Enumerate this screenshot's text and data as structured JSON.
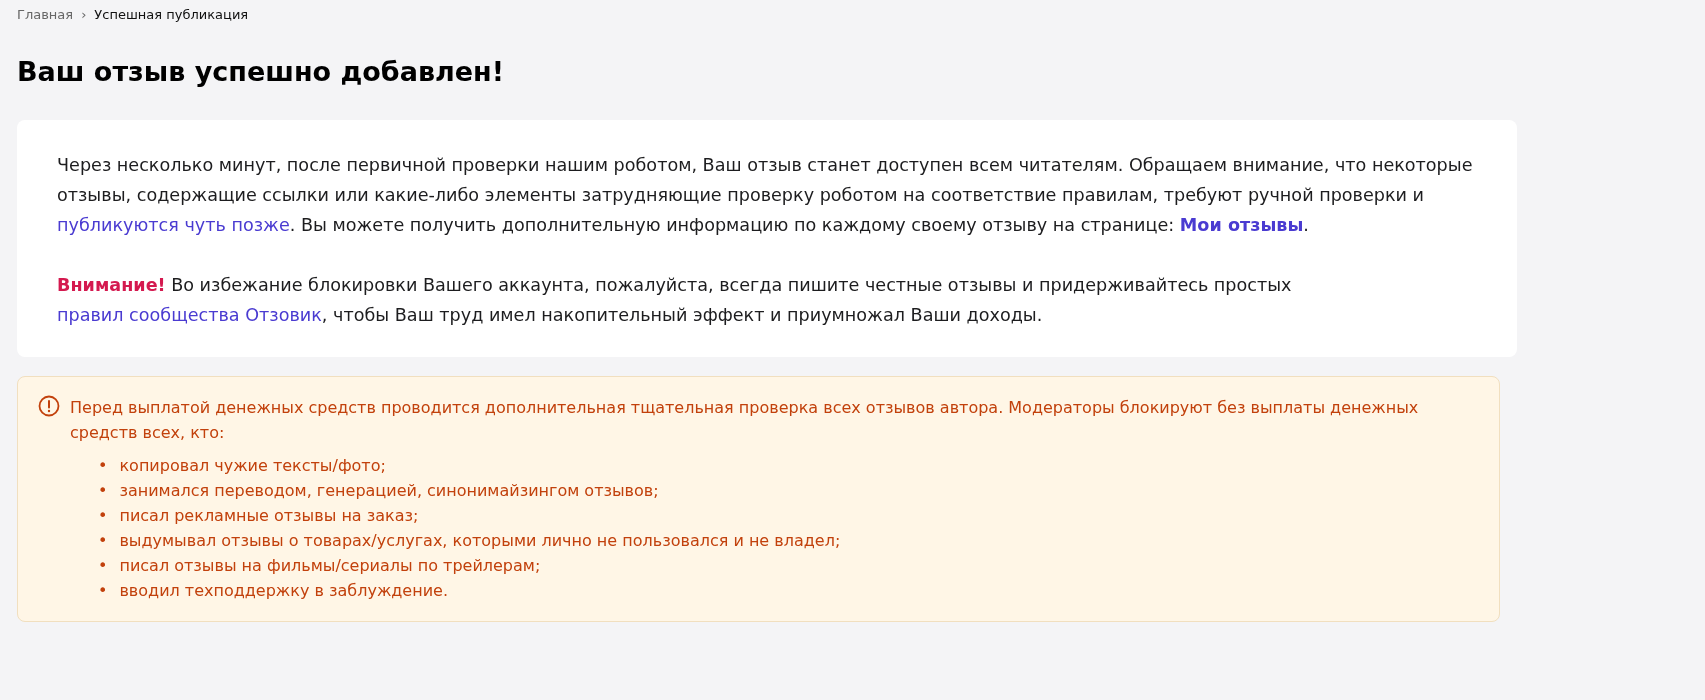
{
  "breadcrumbs": [
    {
      "label": "Главная",
      "current": false
    },
    {
      "label": "Успешная публикация",
      "current": true
    }
  ],
  "breadcrumb_separator": "›",
  "title": "Ваш отзыв успешно добавлен!",
  "card": {
    "paragraphs": [
      [
        {
          "kind": "text",
          "text": "Через несколько минут, после первичной проверки нашим роботом, Ваш отзыв станет доступен всем читателям. Обращаем внимание, что некоторые отзывы, содержащие ссылки или какие-либо элементы затрудняющие проверку роботом на соответствие правилам, требуют ручной проверки и "
        },
        {
          "kind": "link",
          "text": "публикуются чуть позже"
        },
        {
          "kind": "text",
          "text": ". Вы можете получить дополнительную информацию по каждому своему отзыву на странице: "
        },
        {
          "kind": "strong_link",
          "text": "Мои отзывы"
        },
        {
          "kind": "text",
          "text": "."
        }
      ],
      [
        {
          "kind": "warning",
          "text": "Внимание!"
        },
        {
          "kind": "text",
          "text": " Во избежание блокировки Вашего аккаунта, пожалуйста, всегда пишите честные отзывы и придерживайтесь простых "
        },
        {
          "kind": "link",
          "text": "правил сообщества Отзовик"
        },
        {
          "kind": "text",
          "text": ", чтобы Ваш труд имел накопительный эффект и приумножал Ваши доходы."
        }
      ]
    ]
  },
  "notice": {
    "bullet": "•",
    "text": "Перед выплатой денежных средств проводится дополнительная тщательная проверка всех отзывов автора. Модераторы блокируют без выплаты денежных средств всех, кто:",
    "items": [
      "копировал чужие тексты/фото;",
      "занимался переводом, генерацией, синонимайзингом отзывов;",
      "писал рекламные отзывы на заказ;",
      "выдумывал отзывы о товарах/услугах, которыми лично не пользовался и не владел;",
      "писал отзывы на фильмы/сериалы по трейлерам;",
      "вводил техподдержку в заблуждение."
    ]
  }
}
